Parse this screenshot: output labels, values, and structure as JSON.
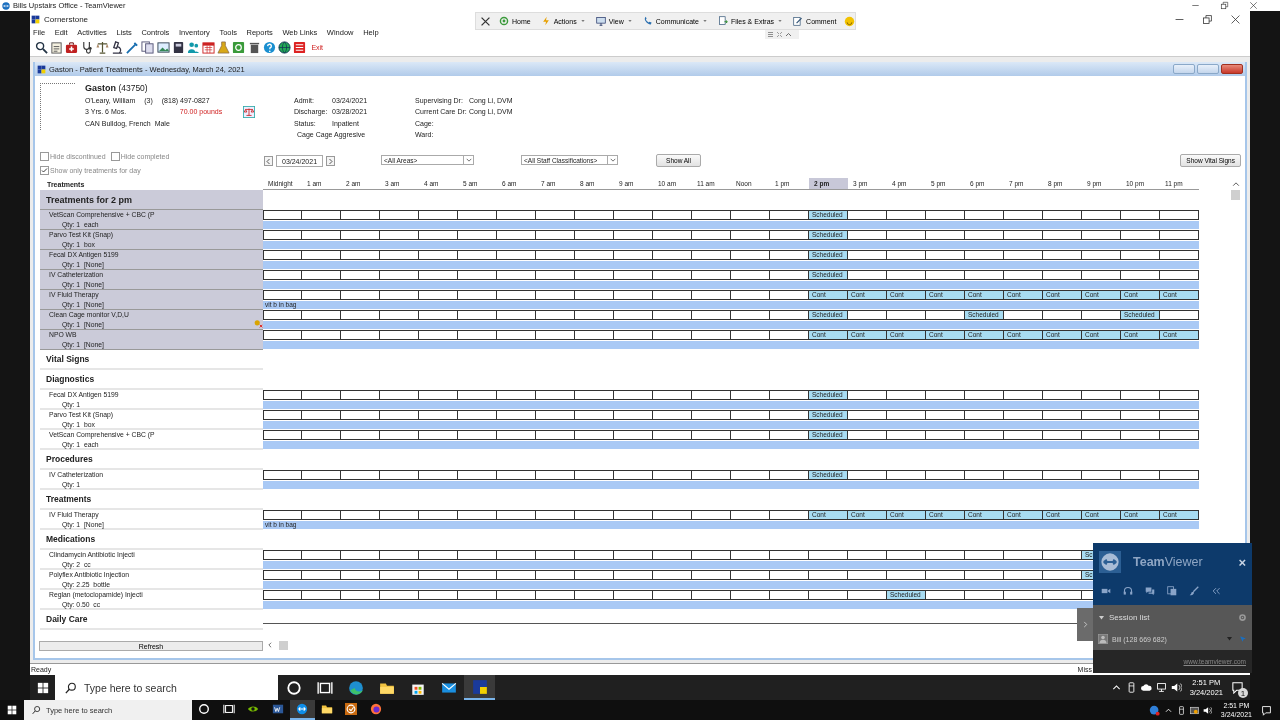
{
  "tv_window": {
    "title": "Bills Upstairs Office - TeamViewer"
  },
  "app": {
    "title": "Cornerstone"
  },
  "tv_toolbar": [
    {
      "kind": "close"
    },
    {
      "kind": "home",
      "label": "Home",
      "has_menu": false
    },
    {
      "kind": "actions",
      "label": "Actions",
      "has_menu": true
    },
    {
      "kind": "view",
      "label": "View",
      "has_menu": true
    },
    {
      "kind": "communicate",
      "label": "Communicate",
      "has_menu": true
    },
    {
      "kind": "files",
      "label": "Files & Extras",
      "has_menu": true
    },
    {
      "kind": "comment",
      "label": "Comment",
      "has_menu": false
    },
    {
      "kind": "feedback"
    }
  ],
  "menu": [
    "File",
    "Edit",
    "Activities",
    "Lists",
    "Controls",
    "Inventory",
    "Tools",
    "Reports",
    "Web Links",
    "Window",
    "Help"
  ],
  "toolbar": {
    "icons": [
      {
        "kind": "search"
      },
      {
        "kind": "clipboard"
      },
      {
        "kind": "bag"
      },
      {
        "kind": "stethoscope"
      },
      {
        "kind": "scale"
      },
      {
        "kind": "microscope"
      },
      {
        "kind": "syringe"
      },
      {
        "kind": "documents"
      },
      {
        "kind": "picture"
      },
      {
        "kind": "book"
      },
      {
        "kind": "people"
      },
      {
        "kind": "calendar"
      },
      {
        "kind": "flask"
      },
      {
        "kind": "greenbox"
      },
      {
        "kind": "trash"
      },
      {
        "kind": "help"
      },
      {
        "kind": "globe"
      },
      {
        "kind": "list"
      }
    ],
    "exit_label": "Exit"
  },
  "child_window": {
    "title": "Gaston - Patient Treatments - Wednesday, March 24, 2021"
  },
  "patient": {
    "name_line": "**Gaston** (43750)",
    "owner": "O'Leary, William",
    "client_count": "(3)",
    "phone": "(818) 497-0827",
    "age": "3 Yrs. 6 Mos.",
    "weight": "70.00 pounds",
    "breed": "CAN Bulldog, French  Male"
  },
  "visit": [
    {
      "label": "Admit:",
      "value": "03/24/2021"
    },
    {
      "label": "Discharge:",
      "value": "03/28/2021"
    },
    {
      "label": "Status:",
      "value": "Inpatient"
    }
  ],
  "alert": "Cage Cage Aggresive",
  "doctors": [
    {
      "label": "Supervising Dr:",
      "value": "Cong Li, DVM"
    },
    {
      "label": "Current Care Dr:",
      "value": "Cong Li, DVM"
    },
    {
      "label": "Cage:"
    },
    {
      "label": "Ward:"
    }
  ],
  "filters": [
    {
      "label": "Hide discontinued",
      "checked": false
    },
    {
      "label": "Hide completed",
      "checked": false
    },
    {
      "label": "Show only treatments for day",
      "checked": true
    }
  ],
  "date": "03/24/2021",
  "area_dropdown": "<All Areas>",
  "staff_dropdown": "<All Staff Classifications>",
  "buttons": {
    "show_all": "Show All",
    "show_vital_signs": "Show Vital Signs",
    "refresh": "Refresh"
  },
  "grid": {
    "column_heading": "Treatments",
    "hours": [
      {
        "label": "Midnight",
        "selected": false
      },
      {
        "label": "1 am",
        "selected": false
      },
      {
        "label": "2 am",
        "selected": false
      },
      {
        "label": "3 am",
        "selected": false
      },
      {
        "label": "4 am",
        "selected": false
      },
      {
        "label": "5 am",
        "selected": false
      },
      {
        "label": "6 am",
        "selected": false
      },
      {
        "label": "7 am",
        "selected": false
      },
      {
        "label": "8 am",
        "selected": false
      },
      {
        "label": "9 am",
        "selected": false
      },
      {
        "label": "10 am",
        "selected": false
      },
      {
        "label": "11 am",
        "selected": false
      },
      {
        "label": "Noon",
        "selected": false
      },
      {
        "label": "1 pm",
        "selected": false
      },
      {
        "label": "2 pm",
        "selected": true
      },
      {
        "label": "3 pm",
        "selected": false
      },
      {
        "label": "4 pm",
        "selected": false
      },
      {
        "label": "5 pm",
        "selected": false
      },
      {
        "label": "6 pm",
        "selected": false
      },
      {
        "label": "7 pm",
        "selected": false
      },
      {
        "label": "8 pm",
        "selected": false
      },
      {
        "label": "9 pm",
        "selected": false
      },
      {
        "label": "10 pm",
        "selected": false
      },
      {
        "label": "11 pm",
        "selected": false
      }
    ],
    "sections": [
      {
        "kind": "current",
        "title": "Treatments for 2 pm",
        "rows": [
          {
            "name": "VetScan Comprehensive + CBC (P",
            "qty": "Qty: 1  each",
            "billing_flag": false,
            "cells": [
              null,
              null,
              null,
              null,
              null,
              null,
              null,
              null,
              null,
              null,
              null,
              null,
              null,
              null,
              "Scheduled",
              null,
              null,
              null,
              null,
              null,
              null,
              null,
              null,
              null
            ]
          },
          {
            "name": "Parvo Test Kit (Snap)",
            "qty": "Qty: 1  box",
            "billing_flag": false,
            "cells": [
              null,
              null,
              null,
              null,
              null,
              null,
              null,
              null,
              null,
              null,
              null,
              null,
              null,
              null,
              "Scheduled",
              null,
              null,
              null,
              null,
              null,
              null,
              null,
              null,
              null
            ]
          },
          {
            "name": "Fecal DX Antigen 5199",
            "qty": "Qty: 1  [None]",
            "billing_flag": false,
            "cells": [
              null,
              null,
              null,
              null,
              null,
              null,
              null,
              null,
              null,
              null,
              null,
              null,
              null,
              null,
              "Scheduled",
              null,
              null,
              null,
              null,
              null,
              null,
              null,
              null,
              null
            ]
          },
          {
            "name": "IV Catheterization",
            "qty": "Qty: 1  [None]",
            "billing_flag": false,
            "cells": [
              null,
              null,
              null,
              null,
              null,
              null,
              null,
              null,
              null,
              null,
              null,
              null,
              null,
              null,
              "Scheduled",
              null,
              null,
              null,
              null,
              null,
              null,
              null,
              null,
              null
            ]
          },
          {
            "name": "IV Fluid Therapy",
            "qty": "Qty: 1  [None]",
            "note": "vit b in bag",
            "billing_flag": false,
            "cells": [
              null,
              null,
              null,
              null,
              null,
              null,
              null,
              null,
              null,
              null,
              null,
              null,
              null,
              null,
              "Cont",
              "Cont",
              "Cont",
              "Cont",
              "Cont",
              "Cont",
              "Cont",
              "Cont",
              "Cont",
              "Cont"
            ]
          },
          {
            "name": "Clean Cage monitor V,D,U",
            "qty": "Qty: 1  [None]",
            "billing_flag": true,
            "cells": [
              null,
              null,
              null,
              null,
              null,
              null,
              null,
              null,
              null,
              null,
              null,
              null,
              null,
              null,
              "Scheduled",
              null,
              null,
              null,
              "Scheduled",
              null,
              null,
              null,
              "Scheduled",
              null
            ]
          },
          {
            "name": "NPO WB",
            "qty": "Qty: 1  [None]",
            "billing_flag": false,
            "cells": [
              null,
              null,
              null,
              null,
              null,
              null,
              null,
              null,
              null,
              null,
              null,
              null,
              null,
              null,
              "Cont",
              "Cont",
              "Cont",
              "Cont",
              "Cont",
              "Cont",
              "Cont",
              "Cont",
              "Cont",
              "Cont"
            ]
          }
        ]
      },
      {
        "kind": "category",
        "title": "Vital Signs"
      },
      {
        "kind": "category",
        "title": "Diagnostics",
        "rows": [
          {
            "name": "Fecal DX Antigen 5199",
            "qty": "Qty: 1",
            "billing_flag": false,
            "cells": [
              null,
              null,
              null,
              null,
              null,
              null,
              null,
              null,
              null,
              null,
              null,
              null,
              null,
              null,
              "Scheduled",
              null,
              null,
              null,
              null,
              null,
              null,
              null,
              null,
              null
            ]
          },
          {
            "name": "Parvo Test Kit (Snap)",
            "qty": "Qty: 1  box",
            "billing_flag": false,
            "cells": [
              null,
              null,
              null,
              null,
              null,
              null,
              null,
              null,
              null,
              null,
              null,
              null,
              null,
              null,
              "Scheduled",
              null,
              null,
              null,
              null,
              null,
              null,
              null,
              null,
              null
            ]
          },
          {
            "name": "VetScan Comprehensive + CBC (P",
            "qty": "Qty: 1  each",
            "billing_flag": false,
            "cells": [
              null,
              null,
              null,
              null,
              null,
              null,
              null,
              null,
              null,
              null,
              null,
              null,
              null,
              null,
              "Scheduled",
              null,
              null,
              null,
              null,
              null,
              null,
              null,
              null,
              null
            ]
          }
        ]
      },
      {
        "kind": "category",
        "title": "Procedures",
        "rows": [
          {
            "name": "IV Catheterization",
            "qty": "Qty: 1",
            "billing_flag": false,
            "cells": [
              null,
              null,
              null,
              null,
              null,
              null,
              null,
              null,
              null,
              null,
              null,
              null,
              null,
              null,
              "Scheduled",
              null,
              null,
              null,
              null,
              null,
              null,
              null,
              null,
              null
            ]
          }
        ]
      },
      {
        "kind": "category",
        "title": "Treatments",
        "rows": [
          {
            "name": "IV Fluid Therapy",
            "qty": "Qty: 1  [None]",
            "note": "vit b in bag",
            "billing_flag": false,
            "cells": [
              null,
              null,
              null,
              null,
              null,
              null,
              null,
              null,
              null,
              null,
              null,
              null,
              null,
              null,
              "Cont",
              "Cont",
              "Cont",
              "Cont",
              "Cont",
              "Cont",
              "Cont",
              "Cont",
              "Cont",
              "Cont"
            ]
          }
        ]
      },
      {
        "kind": "category",
        "title": "Medications",
        "rows": [
          {
            "name": "Clindamycin Antibiotic Injecti",
            "qty": "Qty: 2  cc",
            "billing_flag": false,
            "cells": [
              null,
              null,
              null,
              null,
              null,
              null,
              null,
              null,
              null,
              null,
              null,
              null,
              null,
              null,
              null,
              null,
              null,
              null,
              null,
              null,
              null,
              "Sc",
              null,
              null
            ]
          },
          {
            "name": "Polyflex Antibiotic Injection",
            "qty": "Qty: 2.25  bottle",
            "billing_flag": false,
            "cells": [
              null,
              null,
              null,
              null,
              null,
              null,
              null,
              null,
              null,
              null,
              null,
              null,
              null,
              null,
              null,
              null,
              null,
              null,
              null,
              null,
              null,
              "Sc",
              null,
              null
            ]
          },
          {
            "name": "Reglan (metoclopamide) Injecti",
            "qty": "Qty: 0.50  cc",
            "billing_flag": false,
            "cells": [
              null,
              null,
              null,
              null,
              null,
              null,
              null,
              null,
              null,
              null,
              null,
              null,
              null,
              null,
              null,
              null,
              "Scheduled",
              null,
              null,
              null,
              null,
              null,
              null,
              null
            ]
          }
        ]
      },
      {
        "kind": "category",
        "title": "Daily Care"
      }
    ]
  },
  "status_bar": {
    "text": "Ready",
    "right_text": "Miss"
  },
  "teamviewer_panel": {
    "brand": "**Team**Viewer",
    "close": "×",
    "session_list": "Session list",
    "session": "Bill (128 669 682)",
    "link": "www.teamviewer.com"
  },
  "remote_taskbar": {
    "search": {
      "placeholder": "Type here to search"
    },
    "apps": [
      {
        "kind": "cortana",
        "selected": false
      },
      {
        "kind": "taskview",
        "selected": false
      },
      {
        "kind": "edge",
        "selected": false
      },
      {
        "kind": "folder",
        "selected": false
      },
      {
        "kind": "store",
        "selected": false
      },
      {
        "kind": "mail",
        "selected": false
      },
      {
        "kind": "cornerstone",
        "selected": true
      }
    ],
    "time": "2:51 PM",
    "date": "3/24/2021",
    "notifications": "1"
  },
  "local_taskbar": {
    "search": {
      "placeholder": "Type here to search"
    },
    "apps": [
      {
        "kind": "cortana",
        "selected": false
      },
      {
        "kind": "taskview",
        "selected": false
      },
      {
        "kind": "nvidia",
        "selected": false
      },
      {
        "kind": "word",
        "selected": false
      },
      {
        "kind": "teamviewer",
        "selected": true
      },
      {
        "kind": "folder",
        "selected": false
      },
      {
        "kind": "checkapp",
        "selected": false
      },
      {
        "kind": "firefox",
        "selected": false
      }
    ],
    "time": "2:51 PM",
    "date": "3/24/2021"
  }
}
